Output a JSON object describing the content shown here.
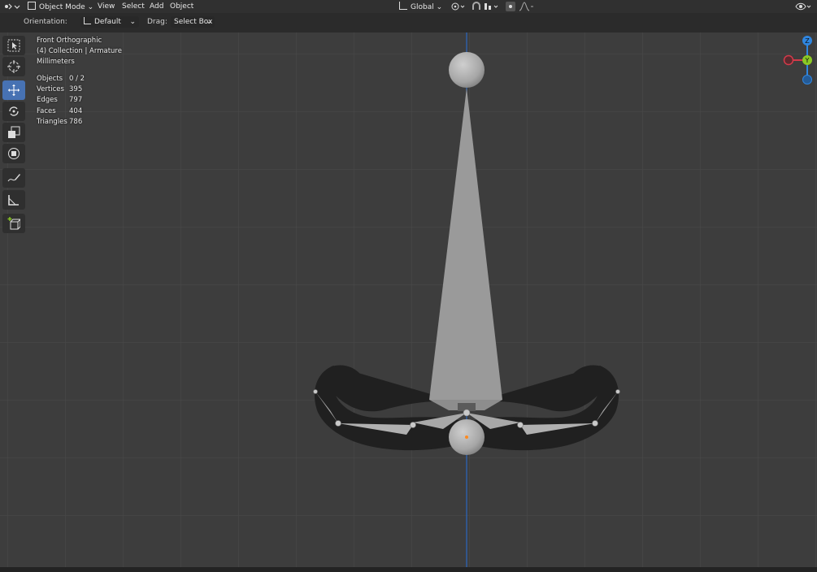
{
  "header": {
    "editor_type_icon": "editor-type-icon",
    "mode": {
      "label": "Object Mode",
      "icon": "object-mode-icon"
    },
    "menus": [
      {
        "name": "menu-view",
        "label": "View"
      },
      {
        "name": "menu-select",
        "label": "Select"
      },
      {
        "name": "menu-add",
        "label": "Add"
      },
      {
        "name": "menu-object",
        "label": "Object"
      }
    ],
    "transform_orientation": {
      "label": "Global",
      "icon": "transform-orientation-icon"
    },
    "pivot_icon": "pivot-point-icon",
    "snap_icon": "snap-icon",
    "snap_target_icon": "snap-increment-icon",
    "proportional_icon": "proportional-editing-icon",
    "falloff_icon": "falloff-icon",
    "visibility_icon": "object-visibility-icon"
  },
  "tool_settings": {
    "orientation_label": "Orientation:",
    "orientation_value": "Default",
    "drag_label": "Drag:",
    "drag_value": "Select Box"
  },
  "tools": [
    {
      "name": "select-box",
      "icon": "select-box-icon",
      "active": false
    },
    {
      "name": "cursor",
      "icon": "cursor-icon",
      "active": false
    },
    {
      "name": "move",
      "icon": "move-icon",
      "active": true
    },
    {
      "name": "rotate",
      "icon": "rotate-icon",
      "active": false
    },
    {
      "name": "scale",
      "icon": "scale-icon",
      "active": false
    },
    {
      "name": "transform",
      "icon": "transform-icon",
      "active": false
    },
    {
      "name": "annotate",
      "icon": "annotate-icon",
      "active": false
    },
    {
      "name": "measure",
      "icon": "measure-icon",
      "active": false
    },
    {
      "name": "add-cube",
      "icon": "add-cube-icon",
      "active": false
    }
  ],
  "viewport_info": {
    "view_name": "Front Orthographic",
    "collection": "(4) Collection | Armature",
    "units": "Millimeters"
  },
  "statistics": [
    {
      "label": "Objects",
      "value": "0 / 2"
    },
    {
      "label": "Vertices",
      "value": "395"
    },
    {
      "label": "Edges",
      "value": "797"
    },
    {
      "label": "Faces",
      "value": "404"
    },
    {
      "label": "Triangles",
      "value": "786"
    }
  ],
  "gizmo": {
    "axes": [
      "Z",
      "Y"
    ],
    "colors": {
      "x": "#d43a4a",
      "y": "#8bc924",
      "z": "#2f86e0"
    }
  },
  "colors": {
    "viewport_bg": "#3d3d3d",
    "header_bg": "#303030",
    "active_tool": "#4772b3",
    "z_axis_line": "#2b68c0",
    "origin": "#ff8a1f"
  }
}
